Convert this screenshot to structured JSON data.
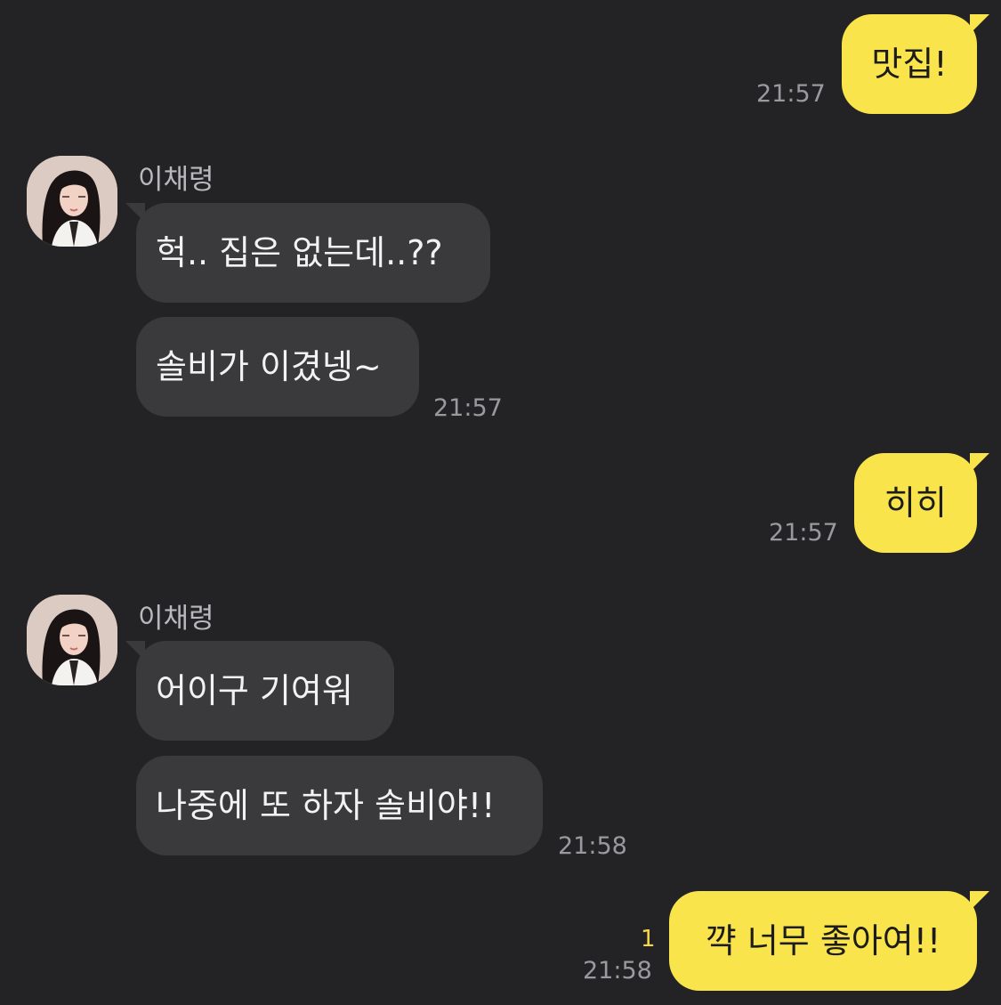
{
  "messages": [
    {
      "side": "me",
      "text": "맛집!",
      "time": "21:57"
    },
    {
      "side": "them",
      "sender": "이채령",
      "text": "헉.. 집은 없는데..??"
    },
    {
      "side": "them",
      "text": "솔비가 이겼넹~",
      "time": "21:57"
    },
    {
      "side": "me",
      "text": "히히",
      "time": "21:57"
    },
    {
      "side": "them",
      "sender": "이채령",
      "text": "어이구 기여워"
    },
    {
      "side": "them",
      "text": "나중에 또 하자 솔비야!!",
      "time": "21:58"
    },
    {
      "side": "me",
      "text": "꺅 너무 좋아여!!",
      "time": "21:58",
      "unread": "1"
    }
  ],
  "colors": {
    "background": "#232325",
    "my_bubble": "#fae44c",
    "their_bubble": "#3a3a3c",
    "timestamp": "#9a9a9e",
    "unread": "#f5d84a"
  },
  "icons": {
    "avatar": "profile-photo"
  }
}
